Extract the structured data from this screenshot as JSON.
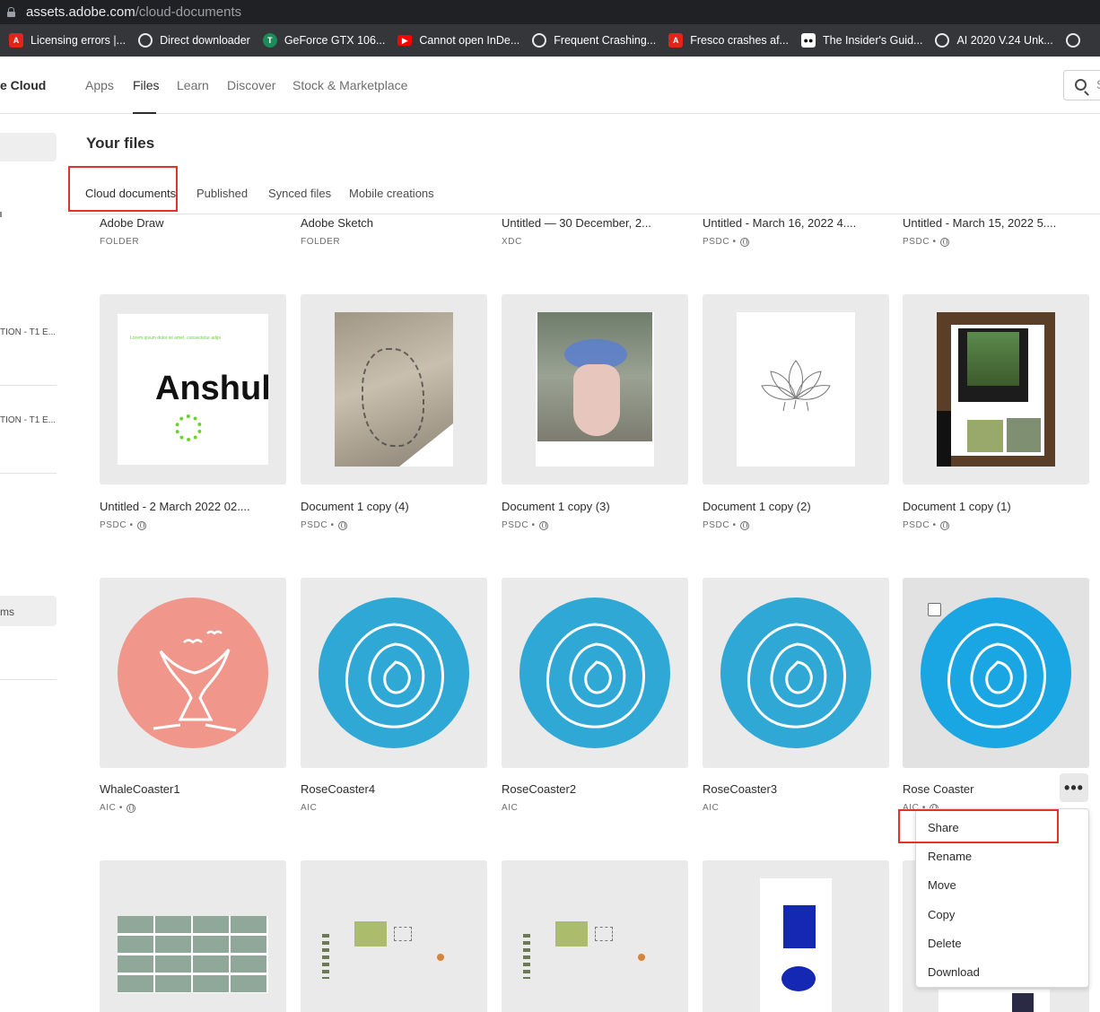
{
  "browser": {
    "url_host": "assets.adobe.com",
    "url_path": "/cloud-documents",
    "bookmarks": [
      {
        "label": "Licensing errors |...",
        "icon": "adobe-icon"
      },
      {
        "label": "Direct downloader",
        "icon": "globe-icon"
      },
      {
        "label": "GeForce GTX 106...",
        "icon": "techpowerup-icon"
      },
      {
        "label": "Cannot open InDe...",
        "icon": "youtube-icon"
      },
      {
        "label": "Frequent Crashing...",
        "icon": "globe-icon"
      },
      {
        "label": "Fresco crashes af...",
        "icon": "adobe-icon"
      },
      {
        "label": "The Insider's Guid...",
        "icon": "medium-icon"
      },
      {
        "label": "AI 2020 V.24 Unk...",
        "icon": "globe-icon"
      }
    ]
  },
  "header": {
    "brand": "e Cloud",
    "nav": [
      "Apps",
      "Files",
      "Learn",
      "Discover",
      "Stock & Marketplace"
    ],
    "active_nav": "Files",
    "search_stub": "S"
  },
  "sidebar": {
    "texts": [
      "TION - T1 E...",
      "TION - T1 E...",
      "ms"
    ]
  },
  "main": {
    "title": "Your files",
    "tabs": [
      "Cloud documents",
      "Published",
      "Synced files",
      "Mobile creations"
    ],
    "active_tab": "Cloud documents"
  },
  "files": {
    "row0": [
      {
        "name": "Adobe Draw",
        "meta": "FOLDER",
        "shared": false
      },
      {
        "name": "Adobe Sketch",
        "meta": "FOLDER",
        "shared": false
      },
      {
        "name": "Untitled — 30 December, 2...",
        "meta": "XDC",
        "shared": false
      },
      {
        "name": "Untitled - March 16, 2022 4....",
        "meta": "PSDC •",
        "shared": true
      },
      {
        "name": "Untitled - March 15, 2022 5....",
        "meta": "PSDC •",
        "shared": true
      }
    ],
    "row1": [
      {
        "name": "Untitled - 2 March 2022 02....",
        "meta": "PSDC •",
        "shared": true
      },
      {
        "name": "Document 1 copy (4)",
        "meta": "PSDC •",
        "shared": true
      },
      {
        "name": "Document 1 copy (3)",
        "meta": "PSDC •",
        "shared": true
      },
      {
        "name": "Document 1 copy (2)",
        "meta": "PSDC •",
        "shared": true
      },
      {
        "name": "Document 1 copy (1)",
        "meta": "PSDC •",
        "shared": true
      }
    ],
    "row2": [
      {
        "name": "WhaleCoaster1",
        "meta": "AIC •",
        "shared": true
      },
      {
        "name": "RoseCoaster4",
        "meta": "AIC",
        "shared": false
      },
      {
        "name": "RoseCoaster2",
        "meta": "AIC",
        "shared": false
      },
      {
        "name": "RoseCoaster3",
        "meta": "AIC",
        "shared": false
      },
      {
        "name": "Rose Coaster",
        "meta": "AIC •",
        "shared": true
      }
    ]
  },
  "thumb_text": {
    "small_green": "Lorem ipsum dolor sit amet, consectetur adipi",
    "big": "Anshul"
  },
  "context_menu": {
    "more_label": "•••",
    "items": [
      "Share",
      "Rename",
      "Move",
      "Copy",
      "Delete",
      "Download"
    ]
  },
  "colors": {
    "highlight_red": "#e0342b",
    "coaster_blue": "#2fa8d5",
    "coaster_salmon": "#f0968a"
  }
}
